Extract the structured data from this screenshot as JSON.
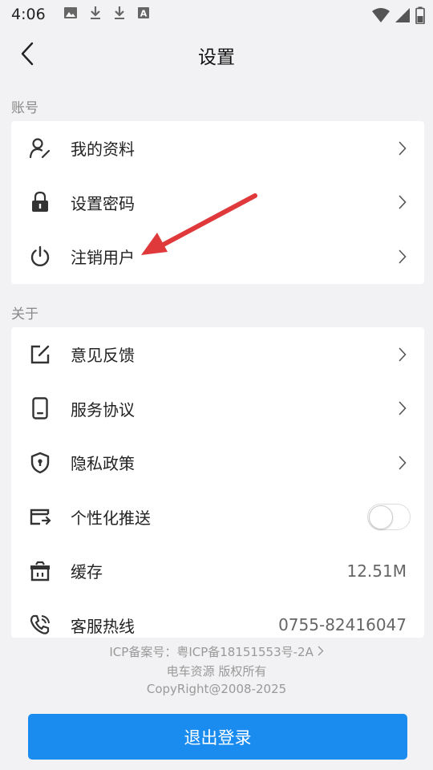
{
  "status_bar": {
    "time": "4:06",
    "left_icons": [
      "image-icon",
      "download-icon",
      "download-icon",
      "font-a-icon"
    ],
    "right_icons": [
      "wifi-icon",
      "signal-icon",
      "battery-icon"
    ]
  },
  "nav": {
    "title": "设置",
    "back_icon": "chevron-left-icon"
  },
  "sections": {
    "account": {
      "label": "账号",
      "items": [
        {
          "label": "我的资料",
          "icon": "user-edit-icon"
        },
        {
          "label": "设置密码",
          "icon": "lock-icon"
        },
        {
          "label": "注销用户",
          "icon": "power-icon"
        }
      ]
    },
    "about": {
      "label": "关于",
      "items": [
        {
          "label": "意见反馈",
          "icon": "edit-square-icon"
        },
        {
          "label": "服务协议",
          "icon": "phone-device-icon"
        },
        {
          "label": "隐私政策",
          "icon": "shield-icon"
        },
        {
          "label": "个性化推送",
          "icon": "card-export-icon",
          "toggle_on": false
        },
        {
          "label": "缓存",
          "icon": "basket-icon",
          "value": "12.51M"
        },
        {
          "label": "客服热线",
          "icon": "phone-call-icon",
          "value": "0755-82416047"
        }
      ]
    }
  },
  "footer": {
    "icp": "ICP备案号：粤ICP备18151553号-2A",
    "copyright_cn": "电车资源 版权所有",
    "copyright_en": "CopyRight@2008-2025"
  },
  "logout_label": "退出登录",
  "colors": {
    "accent": "#1a8cf0",
    "annotation_arrow": "#e0393c",
    "background": "#f2f2f4"
  }
}
